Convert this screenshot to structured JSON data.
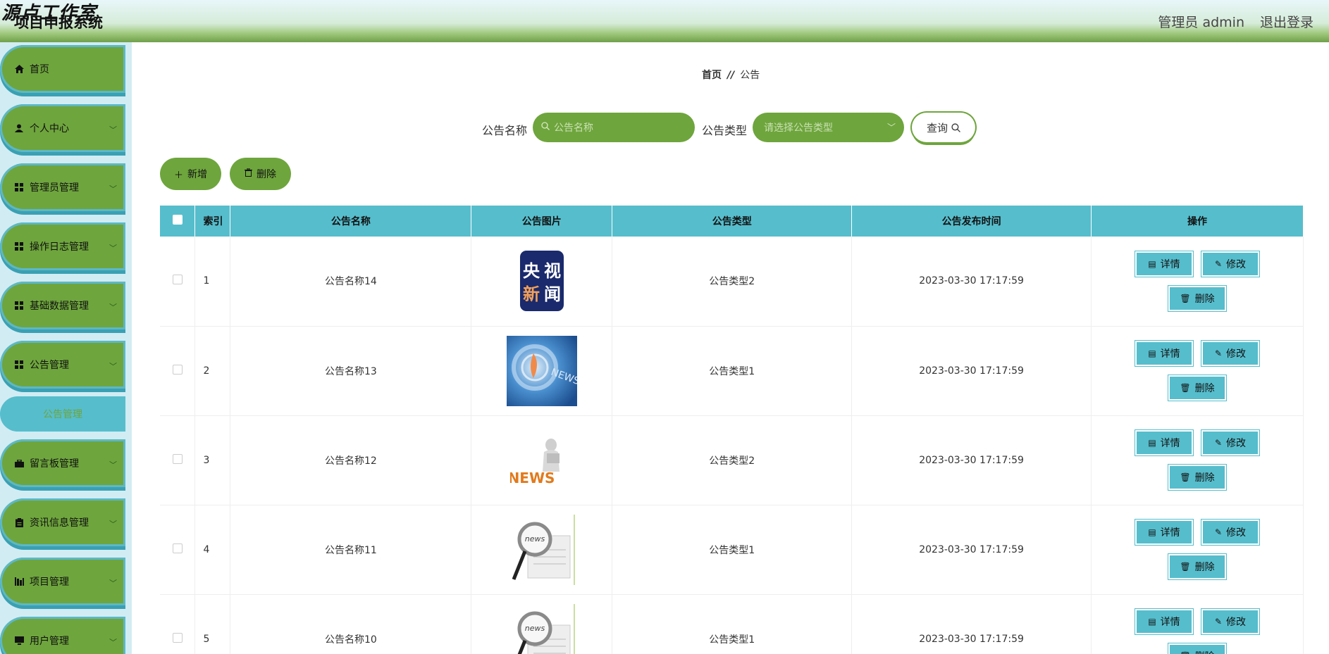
{
  "header": {
    "watermark": "源点工作室",
    "title": "项目申报系统",
    "user": "管理员 admin",
    "logout": "退出登录"
  },
  "sidebar": {
    "items": [
      {
        "label": "首页",
        "icon": "home-icon"
      },
      {
        "label": "个人中心",
        "icon": "user-icon"
      },
      {
        "label": "管理员管理",
        "icon": "grid-icon"
      },
      {
        "label": "操作日志管理",
        "icon": "grid-icon"
      },
      {
        "label": "基础数据管理",
        "icon": "grid-icon"
      },
      {
        "label": "公告管理",
        "icon": "grid-icon"
      },
      {
        "label": "留言板管理",
        "icon": "briefcase-icon"
      },
      {
        "label": "资讯信息管理",
        "icon": "clipboard-icon"
      },
      {
        "label": "项目管理",
        "icon": "chart-icon"
      },
      {
        "label": "用户管理",
        "icon": "monitor-icon"
      }
    ],
    "sub_item": "公告管理"
  },
  "breadcrumb": {
    "home": "首页",
    "sep": "//",
    "current": "公告"
  },
  "search": {
    "name_label": "公告名称",
    "name_placeholder": "公告名称",
    "type_label": "公告类型",
    "type_placeholder": "请选择公告类型",
    "query_button": "查询"
  },
  "actions": {
    "add": "新增",
    "delete": "删除"
  },
  "table": {
    "columns": [
      "索引",
      "公告名称",
      "公告图片",
      "公告类型",
      "公告发布时间",
      "操作"
    ],
    "rows": [
      {
        "index": "1",
        "name": "公告名称14",
        "type": "公告类型2",
        "time": "2023-03-30 17:17:59",
        "image": "cctv-news"
      },
      {
        "index": "2",
        "name": "公告名称13",
        "type": "公告类型1",
        "time": "2023-03-30 17:17:59",
        "image": "news-blue"
      },
      {
        "index": "3",
        "name": "公告名称12",
        "type": "公告类型2",
        "time": "2023-03-30 17:17:59",
        "image": "news-3d"
      },
      {
        "index": "4",
        "name": "公告名称11",
        "type": "公告类型1",
        "time": "2023-03-30 17:17:59",
        "image": "news-magnifier"
      },
      {
        "index": "5",
        "name": "公告名称10",
        "type": "公告类型1",
        "time": "2023-03-30 17:17:59",
        "image": "news-magnifier"
      }
    ],
    "ops": {
      "detail": "详情",
      "edit": "修改",
      "delete": "删除"
    }
  },
  "cctv_logo": {
    "line1a": "央",
    "line1b": "视",
    "line2a": "新",
    "line2b": "闻"
  },
  "img_text": {
    "news": "NEWS",
    "news_lower": "news"
  }
}
